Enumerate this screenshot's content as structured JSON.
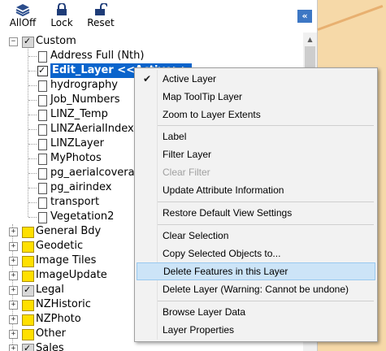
{
  "toolbar": {
    "alloff_label": "AllOff",
    "lock_label": "Lock",
    "reset_label": "Reset",
    "collapse_icon": "«"
  },
  "tree": {
    "root_label": "Custom",
    "custom_children": [
      {
        "label": "Address Full (Nth)",
        "checked": false
      },
      {
        "label": "Edit_Layer <<Active>>",
        "checked": true,
        "selected": true
      },
      {
        "label": "hydrography",
        "checked": false
      },
      {
        "label": "Job_Numbers",
        "checked": false
      },
      {
        "label": "LINZ_Temp",
        "checked": false
      },
      {
        "label": "LINZAerialIndex",
        "checked": false
      },
      {
        "label": "LINZLayer",
        "checked": false
      },
      {
        "label": "MyPhotos",
        "checked": false
      },
      {
        "label": "pg_aerialcoverage",
        "checked": false
      },
      {
        "label": "pg_airindex",
        "checked": false
      },
      {
        "label": "transport",
        "checked": false
      },
      {
        "label": "Vegetation2",
        "checked": false
      }
    ],
    "groups": [
      {
        "label": "General Bdy",
        "checked": false
      },
      {
        "label": "Geodetic",
        "checked": false
      },
      {
        "label": "Image Tiles",
        "checked": false
      },
      {
        "label": "ImageUpdate",
        "checked": false
      },
      {
        "label": "Legal",
        "checked": true
      },
      {
        "label": "NZHistoric",
        "checked": false
      },
      {
        "label": "NZPhoto",
        "checked": false
      },
      {
        "label": "Other",
        "checked": false
      },
      {
        "label": "Sales",
        "checked": true
      }
    ]
  },
  "context_menu": {
    "items": [
      {
        "label": "Active Layer",
        "checked": true,
        "disabled": false
      },
      {
        "label": "Map ToolTip Layer",
        "checked": false,
        "disabled": false
      },
      {
        "label": "Zoom to Layer Extents",
        "checked": false,
        "disabled": false
      },
      {
        "label": "Label",
        "checked": false,
        "disabled": false
      },
      {
        "label": "Filter Layer",
        "checked": false,
        "disabled": false
      },
      {
        "label": "Clear Filter",
        "checked": false,
        "disabled": true
      },
      {
        "label": "Update Attribute Information",
        "checked": false,
        "disabled": false
      },
      {
        "label": "Restore Default View Settings",
        "checked": false,
        "disabled": false
      },
      {
        "label": "Clear Selection",
        "checked": false,
        "disabled": false
      },
      {
        "label": "Copy Selected Objects to...",
        "checked": false,
        "disabled": false
      },
      {
        "label": "Delete Features in this Layer",
        "checked": false,
        "disabled": false,
        "hover": true
      },
      {
        "label": "Delete Layer (Warning: Cannot be undone)",
        "checked": false,
        "disabled": false
      },
      {
        "label": "Browse Layer Data",
        "checked": false,
        "disabled": false
      },
      {
        "label": "Layer Properties",
        "checked": false,
        "disabled": false
      }
    ]
  },
  "colors": {
    "selection": "#0a64cc",
    "folder": "#ffe000",
    "menu_hover": "#cce4f7",
    "map_background": "#f6d9a8"
  }
}
